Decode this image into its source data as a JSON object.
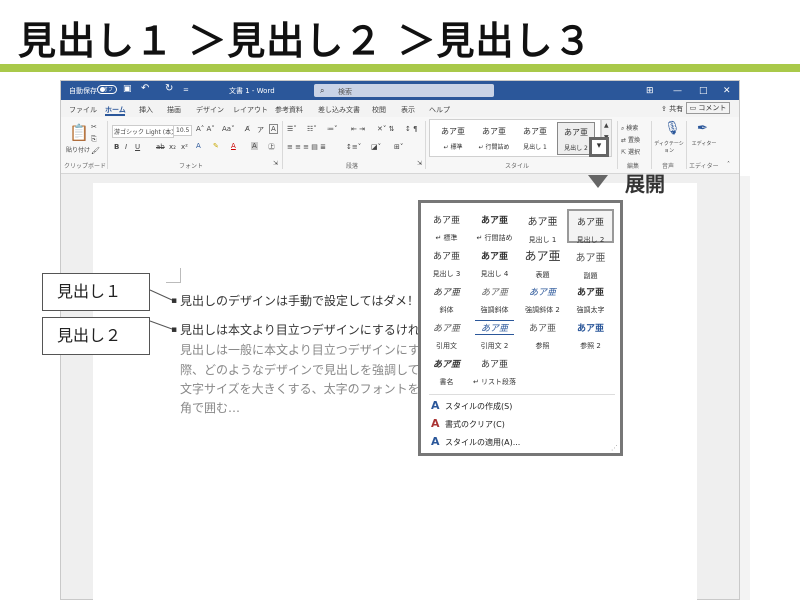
{
  "slide": {
    "title": "見出し１ ＞見出し２ ＞見出し３"
  },
  "word": {
    "titlebar": {
      "autosave": "自動保存",
      "autosave_state": "オフ",
      "undo": "↶",
      "redo": "↻",
      "doc_title": "文書 1  -  Word",
      "search_placeholder": "検索",
      "ribbon_btn": "⊞",
      "minimize": "—",
      "maximize": "□",
      "close": "✕"
    },
    "tabs": [
      "ファイル",
      "ホーム",
      "挿入",
      "描画",
      "デザイン",
      "レイアウト",
      "参考資料",
      "差し込み文書",
      "校閲",
      "表示",
      "ヘルプ"
    ],
    "share": "共有",
    "comment": "コメント",
    "ribbon": {
      "paste": "貼り付け",
      "font_name": "游ゴシック Light (本文",
      "font_size": "10.5",
      "groups": {
        "clipboard": "クリップボード",
        "font": "フォント",
        "paragraph": "段落",
        "styles": "スタイル",
        "edit": "編集",
        "voice": "音声",
        "editor": "エディター"
      },
      "edit_items": [
        "検索",
        "置換",
        "選択"
      ],
      "dictate": "ディクテーション",
      "editor": "エディター",
      "format_buttons": [
        "B",
        "I",
        "U",
        "ab",
        "x₂",
        "x²"
      ],
      "gallery": [
        {
          "preview": "あア亜",
          "name": "↵ 標準"
        },
        {
          "preview": "あア亜",
          "name": "↵ 行間詰め"
        },
        {
          "preview": "あア亜",
          "name": "見出し 1"
        },
        {
          "preview": "あア亜",
          "name": "見出し 2"
        }
      ]
    }
  },
  "annotation": {
    "expand_label": "展開",
    "expand_icon": "▾"
  },
  "document": {
    "lines": [
      "見出しのデザインは手動で設定してはダメ！",
      "見出しは本文より目立つデザインにするけれど…",
      "見出しは一般に本文より目立つデザインにするこ",
      "際、どのようなデザインで見出しを強調していま",
      "文字サイズを大きくする、太字のフォントを使う、",
      "角で囲む…"
    ]
  },
  "callouts": {
    "h1": "見出し１",
    "h2": "見出し２"
  },
  "styles_pane": {
    "styles": [
      {
        "preview": "あア亜",
        "name": "↵ 標準"
      },
      {
        "preview": "あア亜",
        "name": "↵ 行間詰め"
      },
      {
        "preview": "あア亜",
        "name": "見出し 1"
      },
      {
        "preview": "あア亜",
        "name": "見出し 2"
      },
      {
        "preview": "あア亜",
        "name": "見出し 3"
      },
      {
        "preview": "あア亜",
        "name": "見出し 4"
      },
      {
        "preview": "あア亜",
        "name": "表題"
      },
      {
        "preview": "あア亜",
        "name": "副題"
      },
      {
        "preview": "あア亜",
        "name": "斜体"
      },
      {
        "preview": "あア亜",
        "name": "強調斜体"
      },
      {
        "preview": "あア亜",
        "name": "強調斜体 2"
      },
      {
        "preview": "あア亜",
        "name": "強調太字"
      },
      {
        "preview": "あア亜",
        "name": "引用文"
      },
      {
        "preview": "あア亜",
        "name": "引用文 2"
      },
      {
        "preview": "あア亜",
        "name": "参照"
      },
      {
        "preview": "あア亜",
        "name": "参照 2"
      },
      {
        "preview": "あア亜",
        "name": "書名"
      },
      {
        "preview": "あア亜",
        "name": "↵ リスト段落"
      }
    ],
    "actions": [
      "スタイルの作成(S)",
      "書式のクリア(C)",
      "スタイルの適用(A)..."
    ]
  },
  "colors": {
    "title_rule": "#a9c94a",
    "word_blue": "#2b579a"
  }
}
